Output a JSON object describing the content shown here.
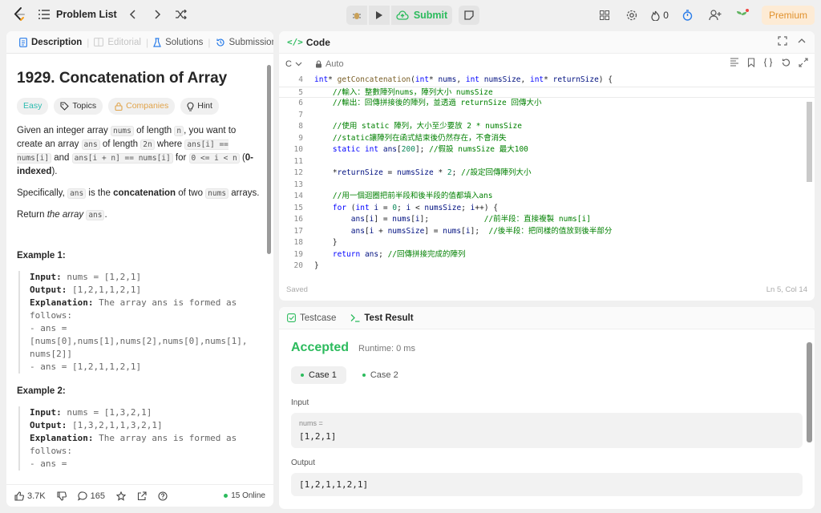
{
  "topbar": {
    "problem_list_label": "Problem List",
    "submit_label": "Submit",
    "streak_count": "0",
    "premium_label": "Premium"
  },
  "left": {
    "tabs": [
      {
        "label": "Description"
      },
      {
        "label": "Editorial"
      },
      {
        "label": "Solutions"
      },
      {
        "label": "Submissions"
      }
    ],
    "title": "1929. Concatenation of Array",
    "tags": {
      "difficulty": "Easy",
      "topics": "Topics",
      "companies": "Companies",
      "hint": "Hint"
    },
    "p1": {
      "t1": "Given an integer array ",
      "c1": "nums",
      "t2": " of length ",
      "c2": "n",
      "t3": ", you want to create an array ",
      "c3": "ans",
      "t4": " of length ",
      "c4": "2n",
      "t5": " where ",
      "c5": "ans[i] == nums[i]",
      "t6": " and ",
      "c6": "ans[i + n] == nums[i]",
      "t7": " for ",
      "c7": "0 <= i < n",
      "t8": " (",
      "b1": "0-indexed",
      "t9": ")."
    },
    "p2": {
      "t1": "Specifically, ",
      "c1": "ans",
      "t2": " is the ",
      "b1": "concatenation",
      "t3": " of two ",
      "c2": "nums",
      "t4": " arrays."
    },
    "p3": {
      "t1": "Return ",
      "i1": "the array",
      "t2": " ",
      "c1": "ans",
      "t3": "."
    },
    "example1": {
      "heading": "Example 1:",
      "input_label": "Input:",
      "input": " nums = [1,2,1]",
      "output_label": "Output:",
      "output": " [1,2,1,1,2,1]",
      "expl_label": "Explanation:",
      "expl_l1": " The array ans is formed as",
      "expl_l2": "follows:",
      "expl_l3": "- ans =",
      "expl_l4": "[nums[0],nums[1],nums[2],nums[0],nums[1],",
      "expl_l5": "nums[2]]",
      "expl_l6": "- ans = [1,2,1,1,2,1]"
    },
    "example2": {
      "heading": "Example 2:",
      "input_label": "Input:",
      "input": " nums = [1,3,2,1]",
      "output_label": "Output:",
      "output": " [1,3,2,1,1,3,2,1]",
      "expl_label": "Explanation:",
      "expl_l1": " The array ans is formed as",
      "expl_l2": "follows:",
      "expl_l3": "- ans ="
    },
    "footer": {
      "likes": "3.7K",
      "comments": "165",
      "online": "15 Online"
    }
  },
  "code": {
    "tab_label": "Code",
    "language": "C",
    "mode": "Auto",
    "status": "Saved",
    "cursor": "Ln 5, Col 14",
    "lines": [
      {
        "n": "4",
        "html": "<span class='k'>int</span>* <span class='fn'>getConcatenation</span>(<span class='k'>int</span>* <span class='vr'>nums</span>, <span class='k'>int</span> <span class='vr'>numsSize</span>, <span class='k'>int</span>* <span class='vr'>returnSize</span>) {"
      },
      {
        "n": "5",
        "html": "    <span class='cm'>//輸入：整數陣列nums，陣列大小 numsSize</span>",
        "cur": true
      },
      {
        "n": "6",
        "html": "    <span class='cm'>//輸出：回傳拼接後的陣列，並透過 returnSize 回傳大小</span>"
      },
      {
        "n": "7",
        "html": ""
      },
      {
        "n": "8",
        "html": "    <span class='cm'>//使用 static 陣列，大小至少要放 2 * numsSize</span>"
      },
      {
        "n": "9",
        "html": "    <span class='cm'>//static讓陣列在函式結束後仍然存在，不會消失</span>"
      },
      {
        "n": "10",
        "html": "    <span class='k'>static</span> <span class='k'>int</span> <span class='vr'>ans</span>[<span class='num'>200</span>]; <span class='cm'>//假設 numsSize 最大100</span>"
      },
      {
        "n": "11",
        "html": ""
      },
      {
        "n": "12",
        "html": "    *<span class='vr'>returnSize</span> = <span class='vr'>numsSize</span> * <span class='num'>2</span>; <span class='cm'>//設定回傳陣列大小</span>"
      },
      {
        "n": "13",
        "html": ""
      },
      {
        "n": "14",
        "html": "    <span class='cm'>//用一個迴圈把前半段和後半段的值都填入ans</span>"
      },
      {
        "n": "15",
        "html": "    <span class='k'>for</span> (<span class='k'>int</span> <span class='vr'>i</span> = <span class='num'>0</span>; <span class='vr'>i</span> &lt; <span class='vr'>numsSize</span>; <span class='vr'>i</span>++) {"
      },
      {
        "n": "16",
        "html": "        <span class='vr'>ans</span>[<span class='vr'>i</span>] = <span class='vr'>nums</span>[<span class='vr'>i</span>];            <span class='cm'>//前半段：直接複製 nums[i]</span>"
      },
      {
        "n": "17",
        "html": "        <span class='vr'>ans</span>[<span class='vr'>i</span> + <span class='vr'>numsSize</span>] = <span class='vr'>nums</span>[<span class='vr'>i</span>];  <span class='cm'>//後半段：把同樣的值放到後半部分</span>"
      },
      {
        "n": "18",
        "html": "    }"
      },
      {
        "n": "19",
        "html": "    <span class='k'>return</span> <span class='vr'>ans</span>; <span class='cm'>//回傳拼接完成的陣列</span>"
      },
      {
        "n": "20",
        "html": "}"
      }
    ]
  },
  "test": {
    "tabs": [
      {
        "label": "Testcase"
      },
      {
        "label": "Test Result"
      }
    ],
    "verdict": "Accepted",
    "runtime": "Runtime: 0 ms",
    "cases": [
      {
        "label": "Case 1"
      },
      {
        "label": "Case 2"
      }
    ],
    "input_label": "Input",
    "input_var": "nums =",
    "input_value": "[1,2,1]",
    "output_label": "Output",
    "output_value": "[1,2,1,1,2,1]"
  }
}
